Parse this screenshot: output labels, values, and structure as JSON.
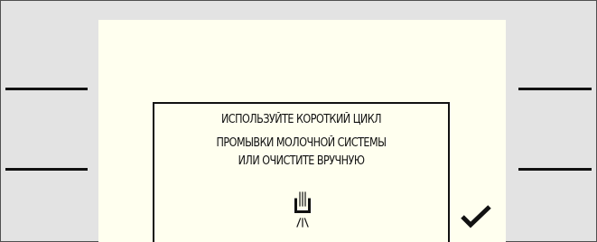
{
  "dialog": {
    "line1": "ИСПОЛЬЗУЙТЕ КОРОТКИЙ ЦИКЛ",
    "line2": "ПРОМЫВКИ МОЛОЧНОЙ СИСТЕМЫ",
    "line3": "ИЛИ ОЧИСТИТЕ ВРУЧНУЮ",
    "icon": "milk-system-rinse-icon"
  },
  "confirm": {
    "icon": "checkmark-icon"
  },
  "colors": {
    "screen_bg": "#ffffef",
    "frame_bg": "#e3e3e3",
    "ink": "#111111"
  }
}
